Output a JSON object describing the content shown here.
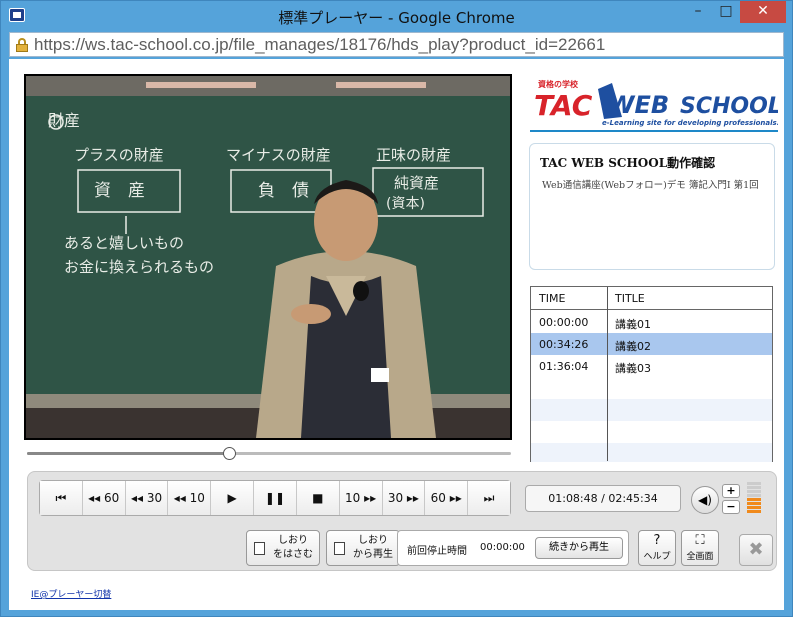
{
  "window": {
    "title": "標準プレーヤー - Google Chrome",
    "minimize_glyph": "–",
    "maximize_glyph": "□",
    "close_glyph": "✕"
  },
  "address_bar": {
    "url": "https://ws.tac-school.co.jp/file_manages/18176/hds_play?product_id=22661"
  },
  "logo": {
    "small_text": "資格の学校",
    "tac": "TAC",
    "web": "WEB",
    "school": "SCHOOL",
    "tagline": "e-Learning site for developing professionals."
  },
  "lecture_info": {
    "title": "TAC WEB SCHOOL動作確認",
    "description": "Web通信講座(Webフォロー)デモ 簿記入門Ⅰ 第1回"
  },
  "chapters": {
    "headers": {
      "time": "TIME",
      "title": "TITLE"
    },
    "rows": [
      {
        "time": "00:00:00",
        "title": "講義01",
        "selected": false
      },
      {
        "time": "00:34:26",
        "title": "講義02",
        "selected": true
      },
      {
        "time": "01:36:04",
        "title": "講義03",
        "selected": false
      }
    ]
  },
  "playback": {
    "progress": 0.418,
    "time_display": "01:08:48 / 02:45:34"
  },
  "transport": {
    "prev": "⏮",
    "back60": "◂◂ 60",
    "back30": "◂◂ 30",
    "back10": "◂◂ 10",
    "play": "▶",
    "pause": "❚❚",
    "stop": "■",
    "fwd10": "10 ▸▸",
    "fwd30": "30 ▸▸",
    "fwd60": "60 ▸▸",
    "next": "⏭"
  },
  "volume": {
    "icon": "◀)",
    "plus": "+",
    "minus": "−",
    "level_bars": 4,
    "total_bars": 8,
    "accent": "#f08a1c"
  },
  "bookmarks": {
    "insert_line1": "しおり",
    "insert_line2": "をはさむ",
    "play_line1": "しおり",
    "play_line2": "から再生"
  },
  "resume": {
    "label": "前回停止時間",
    "time": "00:00:00",
    "button": "続きから再生"
  },
  "help": {
    "glyph": "?",
    "label": "ヘルプ"
  },
  "fullscreen": {
    "glyph": "⛶",
    "label": "全画面"
  },
  "close_player": {
    "glyph": "✖"
  },
  "footer": {
    "link": "IE@プレーヤー切替"
  },
  "board": {
    "heading": "財産",
    "col1": "プラスの財産",
    "col2": "マイナスの財産",
    "col3": "正味の財産",
    "box1": "資　産",
    "box2": "負　債",
    "box3_line1": "純資産",
    "box3_line2": "(資本)",
    "note_line1": "あると嬉しいもの",
    "note_line2": "お金に換えられるもの"
  }
}
